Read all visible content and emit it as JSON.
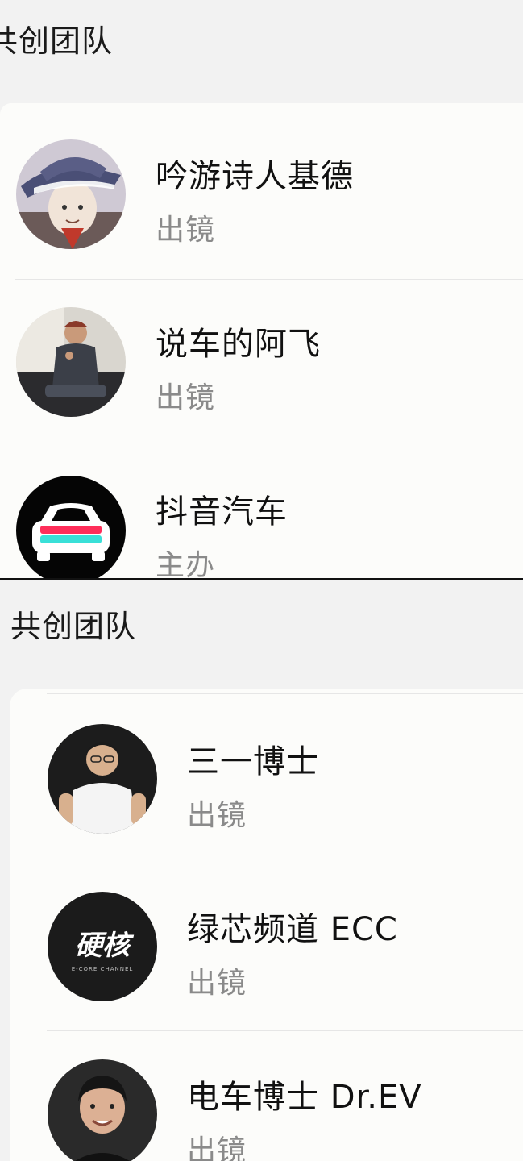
{
  "screens": [
    {
      "section_title": "共创团队",
      "members": [
        {
          "name": "吟游诗人基德",
          "role": "出镜",
          "avatar": "anime-character-avatar"
        },
        {
          "name": "说车的阿飞",
          "role": "出镜",
          "avatar": "person-sitting-photo-avatar"
        },
        {
          "name": "抖音汽车",
          "role": "主办",
          "avatar": "car-logo-avatar"
        }
      ]
    },
    {
      "section_title": "共创团队",
      "members": [
        {
          "name": "三一博士",
          "role": "出镜",
          "avatar": "man-white-shirt-photo-avatar"
        },
        {
          "name": "绿芯频道 ECC",
          "role": "出镜",
          "avatar": "hardcore-channel-logo-avatar",
          "avatar_text": "硬核",
          "avatar_subtext": "E-CORE CHANNEL"
        },
        {
          "name": "电车博士 Dr.EV",
          "role": "出镜",
          "avatar": "man-portrait-photo-avatar"
        }
      ]
    }
  ]
}
